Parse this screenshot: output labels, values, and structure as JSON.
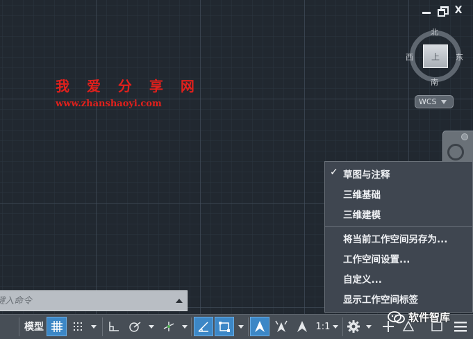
{
  "window_controls": {
    "close_glyph": "X"
  },
  "viewcube": {
    "north": "北",
    "south": "南",
    "east": "东",
    "west": "西",
    "face": "上",
    "wcs_label": "WCS"
  },
  "watermark": {
    "title": "我 爱 分 享 网",
    "url": "www.zhanshaoyi.com",
    "color": "#e0201c"
  },
  "command_line": {
    "placeholder": "键入命令"
  },
  "status_bar": {
    "model_label": "模型",
    "scale_label": "1:1",
    "accent_color": "#3c87c6"
  },
  "workspace_menu": {
    "items": [
      {
        "label": "草图与注释",
        "checked": true
      },
      {
        "label": "三维基础",
        "checked": false
      },
      {
        "label": "三维建模",
        "checked": false
      }
    ],
    "actions": [
      {
        "label": "将当前工作空间另存为..."
      },
      {
        "label": "工作空间设置..."
      },
      {
        "label": "自定义..."
      },
      {
        "label": "显示工作空间标签"
      }
    ],
    "check_glyph": "✓"
  },
  "wechat_watermark": {
    "text": "软件智库"
  }
}
